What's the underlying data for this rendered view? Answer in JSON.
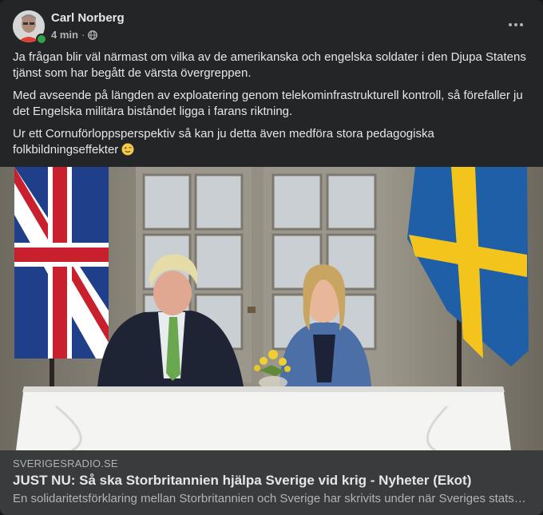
{
  "post": {
    "author": "Carl Norberg",
    "time": "4 min",
    "privacy_icon": "globe-icon",
    "paragraphs": [
      "Ja frågan blir väl närmast om vilka av de amerikanska och engelska soldater i den Djupa Statens tjänst som har begått de värsta övergreppen.",
      "Med avseende på längden av exploatering genom telekominfrastrukturell kontroll, så förefaller ju det Engelska militära biståndet ligga i farans riktning.",
      "Ur ett Cornuförloppsperspektiv så kan ju detta även medföra stora pedagogiska folkbildningseffekter"
    ],
    "emoji": "winking-face-emoji"
  },
  "link": {
    "domain": "SVERIGESRADIO.SE",
    "title": "JUST NU: Så ska Storbritannien hjälpa Sverige vid krig - Nyheter (Ekot)",
    "description": "En solidaritetsförklaring mellan Storbritannien och Sverige har skrivits under när Sveriges statsminister..."
  },
  "colors": {
    "card_bg": "#242526",
    "link_bg": "#3a3b3c",
    "primary_text": "#e4e6eb",
    "secondary_text": "#b0b3b8",
    "online": "#31a24c"
  }
}
